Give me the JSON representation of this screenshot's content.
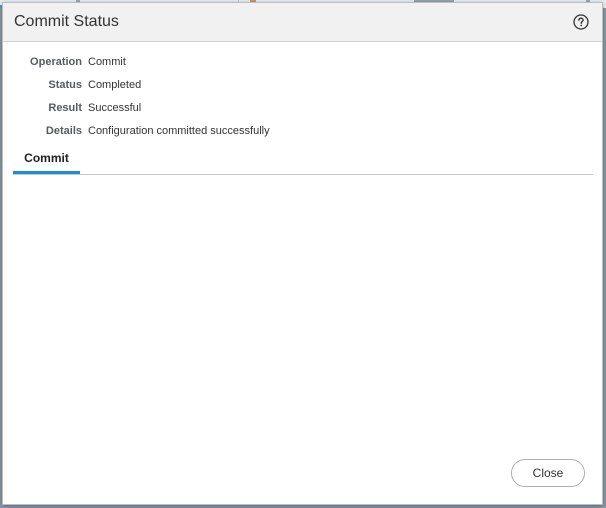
{
  "dialog": {
    "title": "Commit Status",
    "help_icon": "help-circle-icon"
  },
  "details": [
    {
      "label": "Operation",
      "value": "Commit"
    },
    {
      "label": "Status",
      "value": "Completed"
    },
    {
      "label": "Result",
      "value": "Successful"
    },
    {
      "label": "Details",
      "value": "Configuration committed successfully"
    }
  ],
  "tabs": [
    {
      "label": "Commit",
      "active": true
    }
  ],
  "footer": {
    "close_label": "Close"
  },
  "colors": {
    "accent": "#1c8fd4",
    "header_bg": "#f1f1f1",
    "label_text": "#555b60"
  }
}
